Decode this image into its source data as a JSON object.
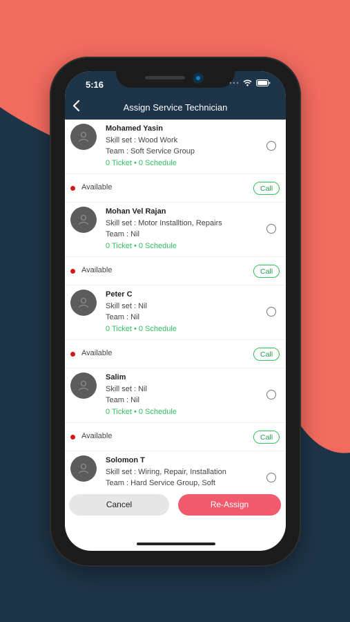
{
  "colors": {
    "background_navy": "#1e3448",
    "background_coral": "#f26b5f",
    "header_navy": "#1e3448",
    "accent_pink": "#f25a6e",
    "green": "#2fbf5a",
    "status_red": "#d11b1b"
  },
  "status_bar": {
    "time": "5:16",
    "icons": [
      "dots-icon",
      "wifi-icon",
      "battery-icon"
    ]
  },
  "header": {
    "title": "Assign Service Technician",
    "back_icon": "chevron-left-icon"
  },
  "technicians": [
    {
      "name": "Mohamed Yasin",
      "skill": "Skill set : Wood Work",
      "team": "Team : Soft Service Group",
      "tickets": "0 Ticket",
      "schedule": "0 Schedule",
      "availability": "Available",
      "call_label": "Call",
      "selected": false
    },
    {
      "name": "Mohan Vel Rajan",
      "skill": "Skill set : Motor Installtion, Repairs",
      "team": "Team : Nil",
      "tickets": "0 Ticket",
      "schedule": "0 Schedule",
      "availability": "Available",
      "call_label": "Call",
      "selected": false
    },
    {
      "name": "Peter C",
      "skill": "Skill set : Nil",
      "team": "Team : Nil",
      "tickets": "0 Ticket",
      "schedule": "0 Schedule",
      "availability": "Available",
      "call_label": "Call",
      "selected": false
    },
    {
      "name": "Salim",
      "skill": "Skill set : Nil",
      "team": "Team : Nil",
      "tickets": "0 Ticket",
      "schedule": "0 Schedule",
      "availability": "Available",
      "call_label": "Call",
      "selected": false
    },
    {
      "name": "Solomon T",
      "skill": "Skill set : Wiring, Repair, Installation",
      "team": "Team : Hard Service Group, Soft",
      "tickets": "",
      "schedule": "",
      "availability": "",
      "call_label": "",
      "selected": false
    }
  ],
  "actions": {
    "cancel_label": "Cancel",
    "reassign_label": "Re-Assign"
  }
}
